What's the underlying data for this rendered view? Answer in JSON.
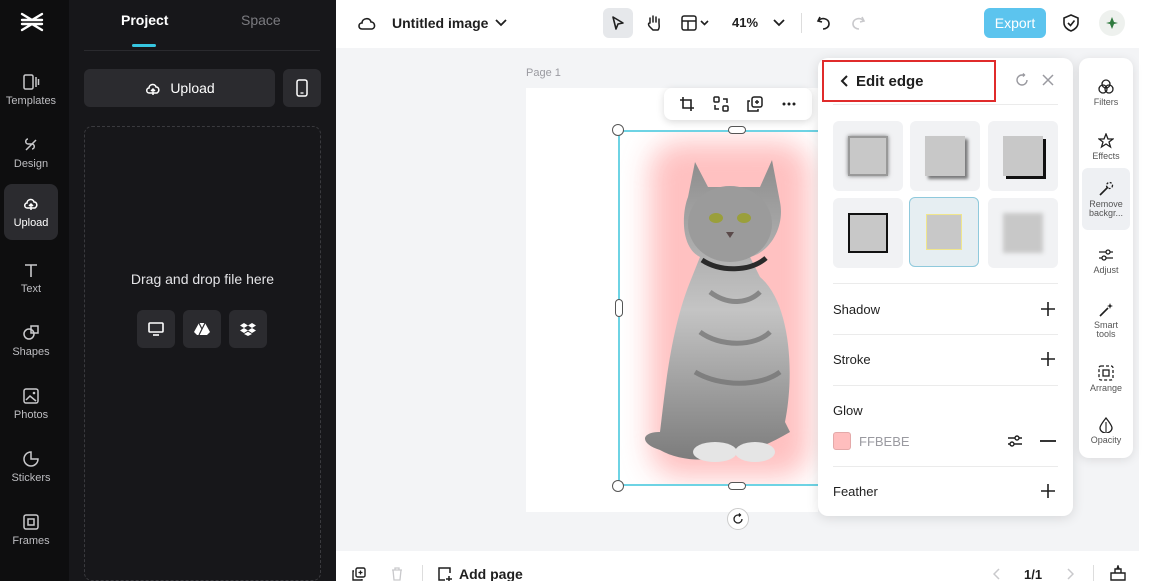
{
  "sidebar": {
    "items": [
      {
        "label": "Templates",
        "icon": "templates-icon"
      },
      {
        "label": "Design",
        "icon": "design-icon"
      },
      {
        "label": "Upload",
        "icon": "upload-cloud-icon"
      },
      {
        "label": "Text",
        "icon": "text-icon"
      },
      {
        "label": "Shapes",
        "icon": "shapes-icon"
      },
      {
        "label": "Photos",
        "icon": "photos-icon"
      },
      {
        "label": "Stickers",
        "icon": "stickers-icon"
      },
      {
        "label": "Frames",
        "icon": "frames-icon"
      }
    ],
    "active": "Upload"
  },
  "panel": {
    "tabs": [
      "Project",
      "Space"
    ],
    "active_tab": "Project",
    "upload_label": "Upload",
    "drop_text": "Drag and drop file here",
    "sources": [
      "computer-icon",
      "google-drive-icon",
      "dropbox-icon"
    ]
  },
  "topbar": {
    "title": "Untitled image",
    "zoom": "41%",
    "export_label": "Export"
  },
  "canvas": {
    "page_label": "Page 1"
  },
  "edit_edge": {
    "title": "Edit edge",
    "sections": {
      "shadow": "Shadow",
      "stroke": "Stroke",
      "glow": "Glow",
      "feather": "Feather"
    },
    "glow_color": "FFBEBE",
    "glow_swatch_hex": "#FFBEBE"
  },
  "tools": {
    "filters": "Filters",
    "effects": "Effects",
    "remove_bg": "Remove backgr...",
    "adjust": "Adjust",
    "smart": "Smart tools",
    "arrange": "Arrange",
    "opacity": "Opacity"
  },
  "bottombar": {
    "add_page": "Add page",
    "pagination": "1/1"
  },
  "colors": {
    "accent": "#36C6E0",
    "export_button": "#5CC4EE",
    "highlight_border": "#E02B2B"
  }
}
